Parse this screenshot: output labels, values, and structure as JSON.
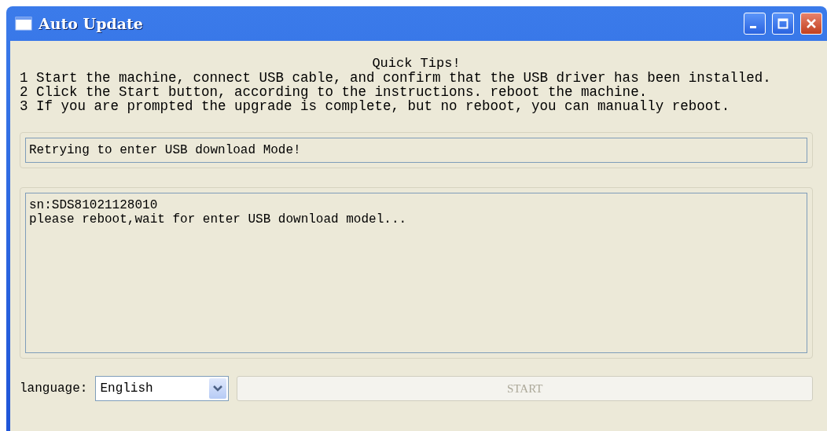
{
  "window": {
    "title": "Auto Update"
  },
  "tips": {
    "title": "Quick Tips!",
    "lines": [
      "1 Start the machine, connect USB cable, and confirm that the USB driver has been installed.",
      "2 Click the Start button, according to the instructions. reboot the machine.",
      "3 If you are prompted the upgrade is complete, but no reboot, you can manually reboot."
    ]
  },
  "status": {
    "value": "Retrying to enter USB download Mode!"
  },
  "log": {
    "lines": [
      "sn:SDS81021128010",
      "please reboot,wait for enter USB download model..."
    ]
  },
  "language": {
    "label": "language:",
    "value": "English"
  },
  "start_button": {
    "label": "START",
    "disabled": true
  }
}
